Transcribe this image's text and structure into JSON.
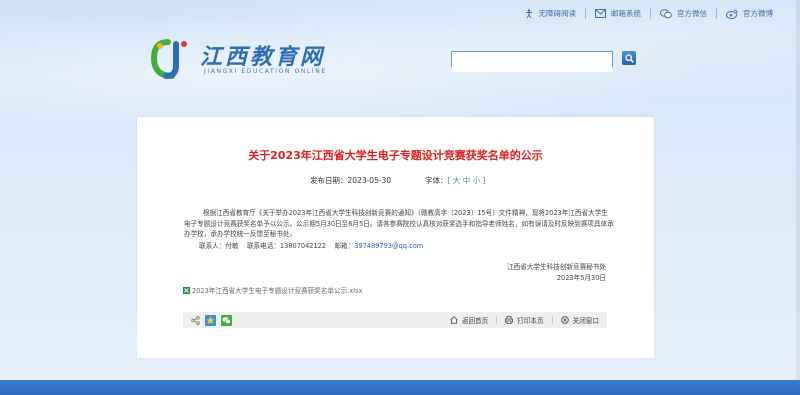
{
  "header": {
    "links": [
      {
        "label": "无障碍阅读",
        "icon": "accessibility-icon"
      },
      {
        "label": "邮箱系统",
        "icon": "mail-icon"
      },
      {
        "label": "官方微信",
        "icon": "wechat-icon"
      },
      {
        "label": "官方微博",
        "icon": "weibo-icon"
      }
    ],
    "logo_cn": "江西教育网",
    "logo_en": "JIANGXI EDUCATION ONLINE",
    "search_placeholder": ""
  },
  "article": {
    "title": "关于2023年江西省大学生电子专题设计竞赛获奖名单的公示",
    "date_label": "发布日期：",
    "date": "2023-05-30",
    "font_label": "字体：",
    "font_sizes": "[ 大 中 小 ]",
    "paragraph": "根据江西省教育厅《关于举办2023年江西省大学生科技创新竞赛的通知》（赣教高字〔2023〕15号）文件精神，现将2023年江西省大学生电子专题设计竞赛获奖名单予以公示。公示期5月30日至6月5日。请各参赛院校认真核对获奖选手和指导老师姓名，如有误请及时反映到赛项具体承办学校，承办学校统一反馈至秘书处。",
    "contact_person": "联系人：付敏",
    "contact_phone": "联系电话：13807042122",
    "contact_email_label": "邮箱：",
    "contact_email": "397489793@qq.com",
    "signer": "江西省大学生科技创新竞赛秘书处",
    "sign_date": "2023年5月30日",
    "attachment": "2023年江西省大学生电子专题设计竞赛获奖名单公示.xlsx"
  },
  "toolbar": {
    "back_top": "返回首页",
    "print": "打印本页",
    "close": "关闭窗口"
  },
  "colors": {
    "title": "#e0201f",
    "accent": "#2f6db5",
    "footer": "#2c6cc0"
  }
}
